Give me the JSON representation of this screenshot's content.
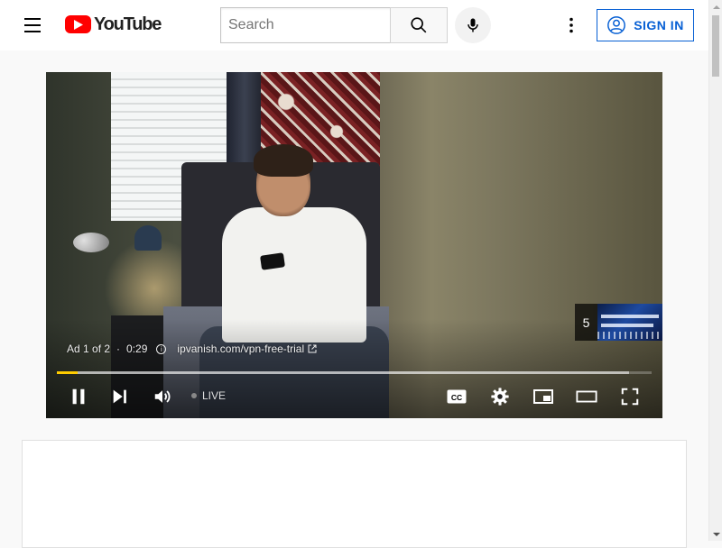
{
  "masthead": {
    "logo_text": "YouTube",
    "search_placeholder": "Search",
    "search_value": "",
    "signin_label": "SIGN IN"
  },
  "player": {
    "ad_label": "Ad 1 of 2",
    "ad_separator": "·",
    "ad_time": "0:29",
    "ad_url": "ipvanish.com/vpn-free-trial",
    "skip_count": "5",
    "live_label": "LIVE",
    "progress_played": 0.035,
    "progress_loaded": 0.962
  },
  "colors": {
    "brand_red": "#ff0000",
    "signin_blue": "#065fd4",
    "ad_progress": "#ffcc00"
  },
  "icons": {
    "menu": "hamburger-icon",
    "search": "search-icon",
    "mic": "microphone-icon",
    "more": "more-vertical-icon",
    "account": "account-circle-icon",
    "pause": "pause-icon",
    "next": "skip-next-icon",
    "volume": "volume-icon",
    "cc": "closed-captions-icon",
    "settings": "gear-icon",
    "miniplayer": "miniplayer-icon",
    "theater": "theater-mode-icon",
    "fullscreen": "fullscreen-icon",
    "info": "info-icon",
    "external": "external-link-icon"
  }
}
